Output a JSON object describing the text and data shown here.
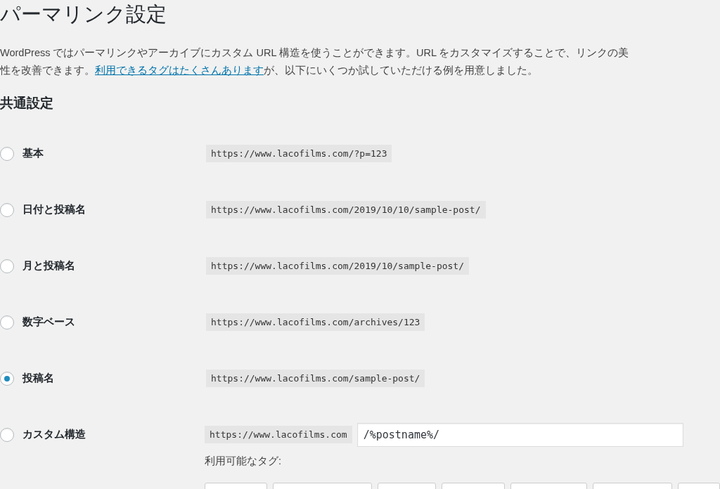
{
  "page_title": "パーマリンク設定",
  "intro": {
    "line_1": "WordPress ではパーマリンクやアーカイブにカスタム URL 構造を使うことができます。URL をカスタマイズすることで、リンクの美",
    "line_2_before": "性を改善できます。",
    "link": "利用できるタグはたくさんあります",
    "line_2_after": "が、以下にいくつか試していただける例を用意しました。"
  },
  "section_title": "共通設定",
  "options": [
    {
      "label": "基本",
      "url": "https://www.lacofilms.com/?p=123",
      "selected": false,
      "kind": "preset"
    },
    {
      "label": "日付と投稿名",
      "url": "https://www.lacofilms.com/2019/10/10/sample-post/",
      "selected": false,
      "kind": "preset"
    },
    {
      "label": "月と投稿名",
      "url": "https://www.lacofilms.com/2019/10/sample-post/",
      "selected": false,
      "kind": "preset"
    },
    {
      "label": "数字ベース",
      "url": "https://www.lacofilms.com/archives/123",
      "selected": false,
      "kind": "preset"
    },
    {
      "label": "投稿名",
      "url": "https://www.lacofilms.com/sample-post/",
      "selected": true,
      "kind": "preset"
    },
    {
      "label": "カスタム構造",
      "url": "https://www.lacofilms.com",
      "value": "/%postname%/",
      "selected": false,
      "kind": "custom",
      "tags_label": "利用可能なタグ:"
    }
  ]
}
